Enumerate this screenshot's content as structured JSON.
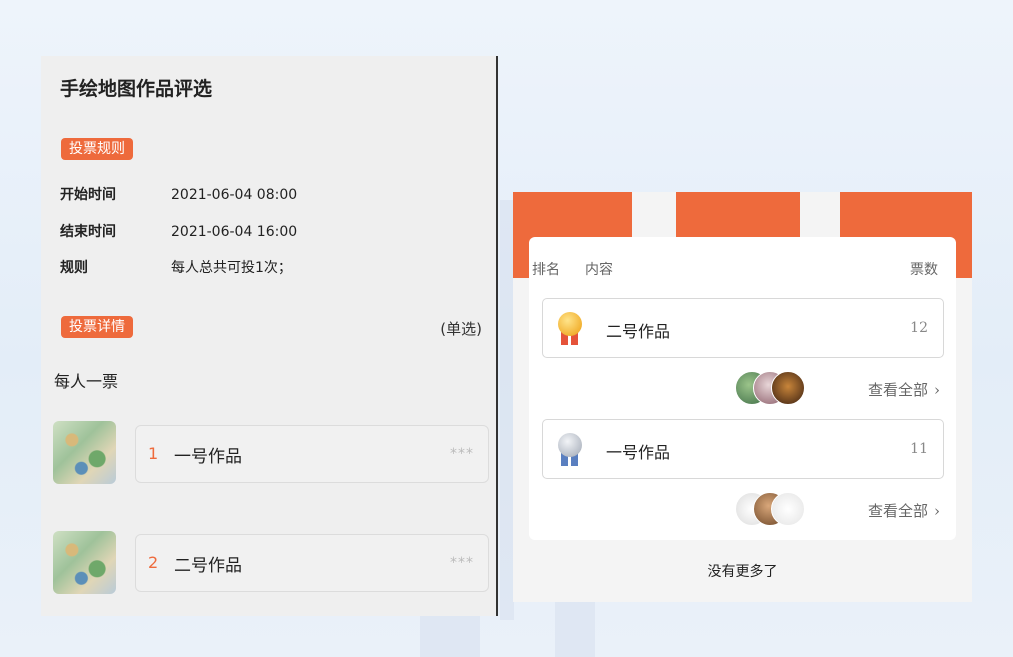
{
  "left": {
    "title": "手绘地图作品评选",
    "rules_tag": "投票规则",
    "info": [
      {
        "key": "开始时间",
        "value": "2021-06-04 08:00"
      },
      {
        "key": "结束时间",
        "value": "2021-06-04 16:00"
      },
      {
        "key": "规则",
        "value": "每人总共可投1次；"
      }
    ],
    "details_tag": "投票详情",
    "selection_mode": "(单选)",
    "per_person": "每人一票",
    "works": [
      {
        "num": "1",
        "name": "一号作品",
        "mask": "***"
      },
      {
        "num": "2",
        "name": "二号作品",
        "mask": "***"
      }
    ]
  },
  "right": {
    "col_rank": "排名",
    "col_content": "内容",
    "col_votes": "票数",
    "ranking": [
      {
        "name": "二号作品",
        "votes": "12",
        "medal": "gold-medal-icon",
        "see_all": "查看全部"
      },
      {
        "name": "一号作品",
        "votes": "11",
        "medal": "silver-medal-icon",
        "see_all": "查看全部"
      }
    ],
    "no_more": "没有更多了"
  },
  "colors": {
    "accent": "#ee6a3c",
    "gold": "#f2b233",
    "silver": "#b8bec8",
    "ribbon_gold": "#e5533a",
    "ribbon_silver": "#5a7fc0"
  },
  "chevron": "›"
}
